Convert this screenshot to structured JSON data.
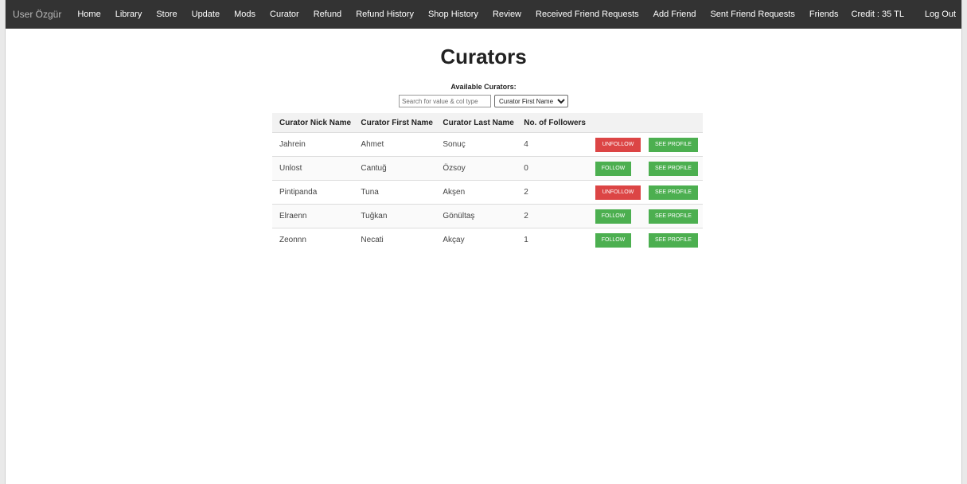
{
  "nav": {
    "user": "User Özgür",
    "links": [
      "Home",
      "Library",
      "Store",
      "Update",
      "Mods",
      "Curator",
      "Refund",
      "Refund History",
      "Shop History",
      "Review",
      "Received Friend Requests",
      "Add Friend",
      "Sent Friend Requests",
      "Friends"
    ],
    "credit": "Credit : 35 TL",
    "logout": "Log Out"
  },
  "page": {
    "title": "Curators",
    "subtitle": "Available Curators:"
  },
  "search": {
    "placeholder": "Search for value & col type",
    "selected": "Curator First Name"
  },
  "table": {
    "headers": [
      "Curator Nick Name",
      "Curator First Name",
      "Curator Last Name",
      "No. of Followers"
    ],
    "profile_label": "SEE PROFILE",
    "rows": [
      {
        "nick": "Jahrein",
        "first": "Ahmet",
        "last": "Sonuç",
        "followers": "4",
        "action": "UNFOLLOW"
      },
      {
        "nick": "Unlost",
        "first": "Cantuğ",
        "last": "Özsoy",
        "followers": "0",
        "action": "FOLLOW"
      },
      {
        "nick": "Pintipanda",
        "first": "Tuna",
        "last": "Akşen",
        "followers": "2",
        "action": "UNFOLLOW"
      },
      {
        "nick": "Elraenn",
        "first": "Tuğkan",
        "last": "Gönültaş",
        "followers": "2",
        "action": "FOLLOW"
      },
      {
        "nick": "Zeonnn",
        "first": "Necati",
        "last": "Akçay",
        "followers": "1",
        "action": "FOLLOW"
      }
    ]
  },
  "colors": {
    "navbar": "#333333",
    "follow": "#4caf50",
    "unfollow": "#dc4545"
  }
}
